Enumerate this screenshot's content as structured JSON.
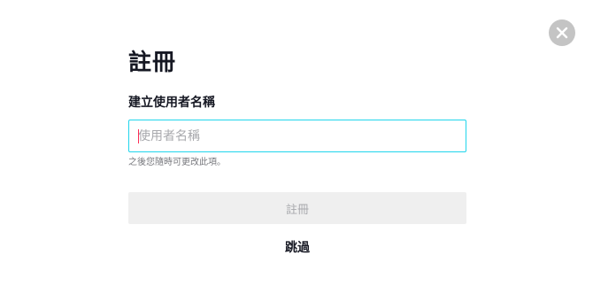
{
  "dialog": {
    "close_icon": "close-icon",
    "title": "註冊",
    "username": {
      "label": "建立使用者名稱",
      "value": "",
      "placeholder": "使用者名稱",
      "hint": "之後您隨時可更改此項。"
    },
    "submit_label": "註冊",
    "skip_label": "跳過"
  },
  "colors": {
    "accent_border": "#20d5ec",
    "caret": "#fe2c55",
    "close_bg": "#c4c4c4",
    "disabled_bg": "#efefef",
    "disabled_text": "#a8a9ad",
    "text": "#161823"
  }
}
